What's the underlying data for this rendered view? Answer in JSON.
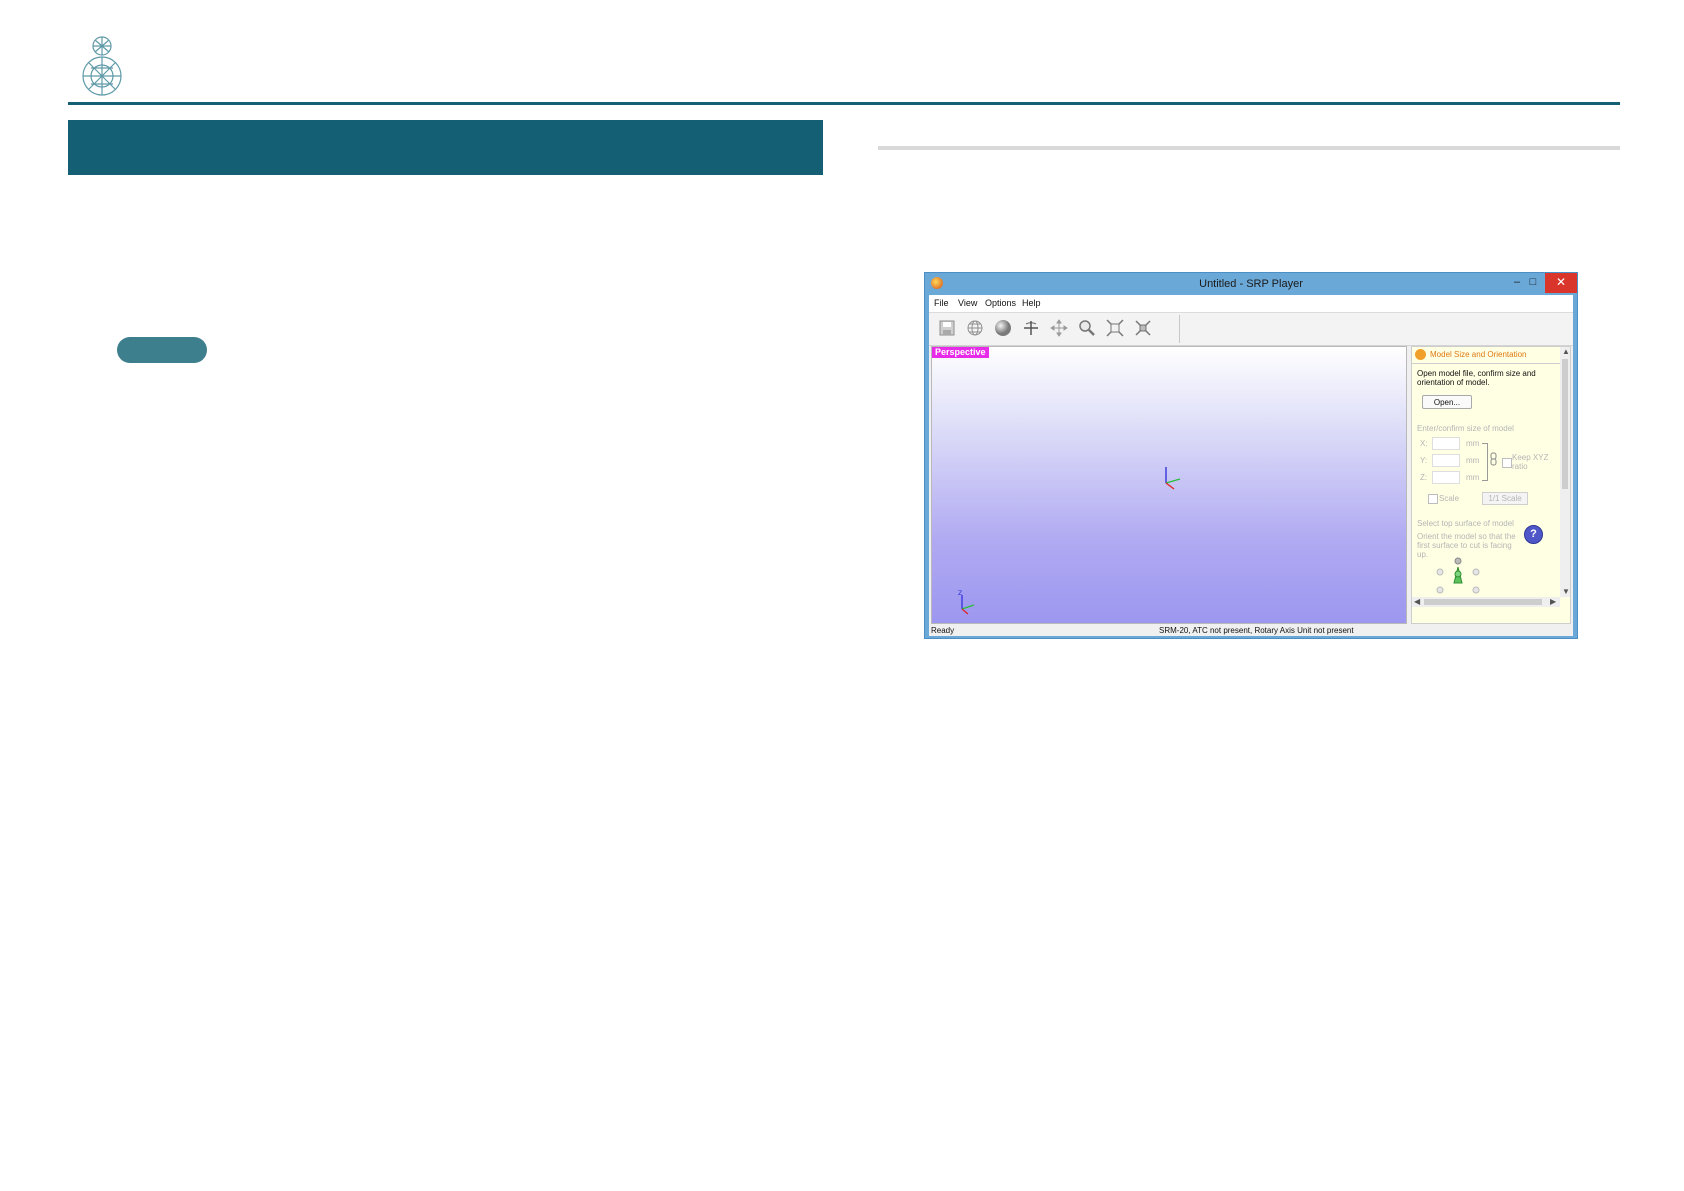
{
  "window": {
    "title": "Untitled - SRP Player",
    "min_glyph": "–",
    "max_glyph": "□",
    "close_glyph": "✕"
  },
  "menu": [
    "File",
    "View",
    "Options",
    "Help"
  ],
  "toolbar_icons": [
    "save-icon",
    "wireframe-icon",
    "render-sphere-icon",
    "rotate-icon",
    "pan-icon",
    "zoom-icon",
    "fit-icon",
    "expand-icon"
  ],
  "viewport": {
    "label": "Perspective"
  },
  "panel": {
    "title": "Model Size and Orientation",
    "description": "Open model file, confirm size and orientation of model.",
    "open_button": "Open...",
    "size_label": "Enter/confirm size of model",
    "axes": [
      "X:",
      "Y:",
      "Z:"
    ],
    "unit": "mm",
    "keep_ratio": "Keep XYZ ratio",
    "scale_label": "Scale",
    "one_scale_button": "1/1 Scale",
    "top_surface": "Select top surface of model",
    "orient_text": "Orient the model so that the first surface to cut is facing up.",
    "help_glyph": "?"
  },
  "status": {
    "ready": "Ready",
    "machine": "SRM-20, ATC not present, Rotary Axis Unit not present"
  },
  "colors": {
    "brand_teal": "#145f73",
    "pill": "#3d7f8c",
    "window_border": "#6aa8d8",
    "close_red": "#d9352a",
    "perspective_magenta": "#e82be8",
    "panel_title": "#e07a12"
  }
}
